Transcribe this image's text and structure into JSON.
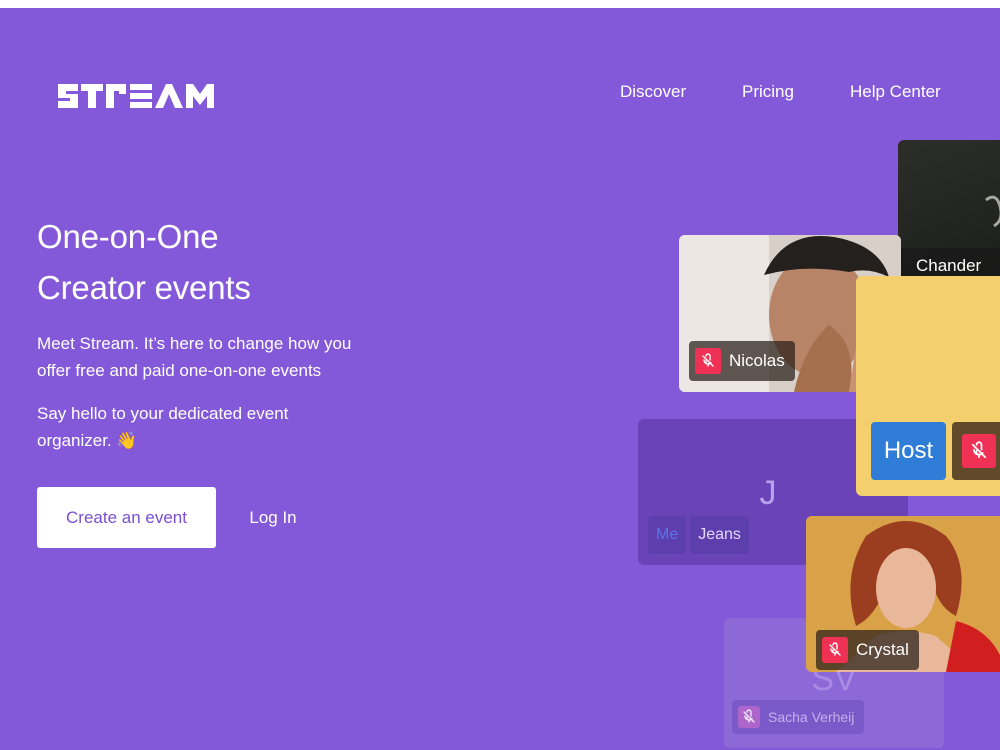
{
  "brand": {
    "name": "STREAM"
  },
  "nav": {
    "links": [
      "Discover",
      "Pricing",
      "Help Center"
    ]
  },
  "hero": {
    "title_line1": "One-on-One",
    "title_line2": "Creator events",
    "para1": "Meet Stream. It’s here to change how you offer free and paid one-on-one events",
    "para2": "Say hello to your dedicated event organizer. 👋",
    "primary_cta": "Create an event",
    "secondary_cta": "Log In"
  },
  "tiles": {
    "chander": {
      "name": "Chander"
    },
    "nicolas": {
      "name": "Nicolas"
    },
    "host": {
      "badge": "Host"
    },
    "jeans": {
      "initial": "J",
      "me": "Me",
      "name": "Jeans"
    },
    "crystal": {
      "name": "Crystal"
    },
    "sacha": {
      "initial": "SV",
      "name": "Sacha Verheij"
    }
  },
  "colors": {
    "background": "#8459d9",
    "mute_red": "#ef3155",
    "host_blue": "#2f7dd6",
    "tile_yellow": "#f4cf6e"
  },
  "icons": [
    "mic-off-icon",
    "waving-hand-icon"
  ]
}
